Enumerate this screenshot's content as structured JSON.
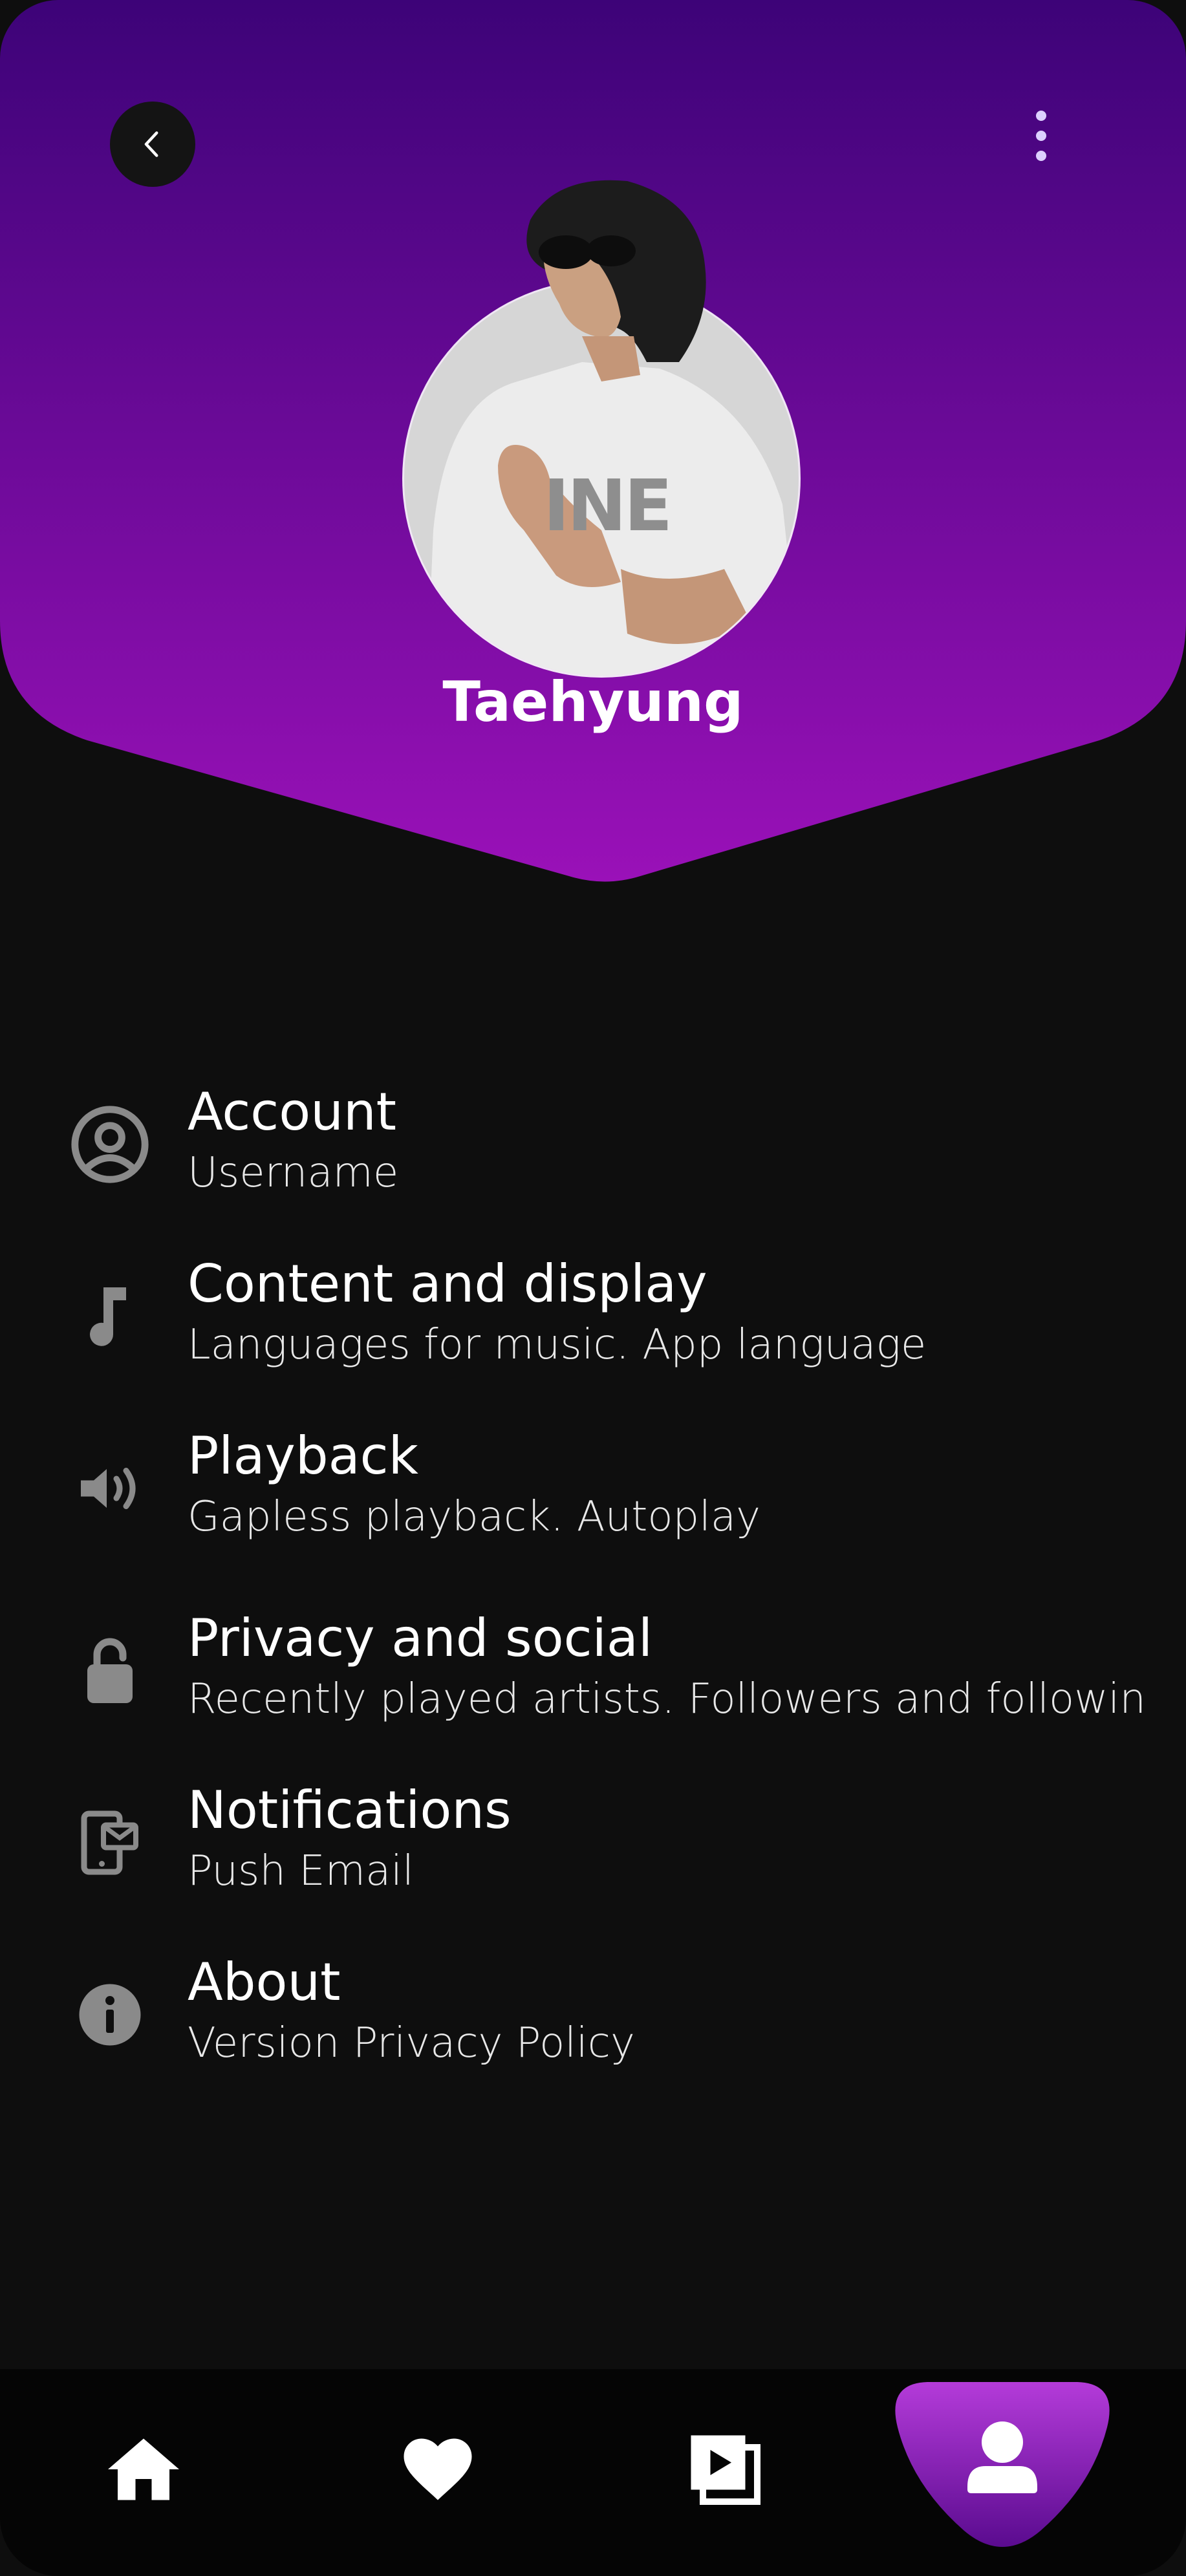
{
  "profile": {
    "name": "Taehyung"
  },
  "header": {
    "back_icon": "chevron-left-icon",
    "more_icon": "more-vertical-icon",
    "gradient_top": "#3d0378",
    "gradient_bottom": "#9a11b8"
  },
  "settings": {
    "items": [
      {
        "title": "Account",
        "subtitle": "Username",
        "icon": "account-circle-icon"
      },
      {
        "title": "Content and display",
        "subtitle": "Languages for music. App language",
        "icon": "music-note-icon"
      },
      {
        "title": "Playback",
        "subtitle": "Gapless playback. Autoplay",
        "icon": "volume-icon"
      },
      {
        "title": "Privacy and social",
        "subtitle": "Recently played artists. Followers and followin",
        "icon": "lock-icon"
      },
      {
        "title": "Notifications",
        "subtitle": "Push Email",
        "icon": "mail-phone-icon"
      },
      {
        "title": "About",
        "subtitle": "Version Privacy Policy",
        "icon": "info-icon"
      }
    ]
  },
  "bottom_nav": {
    "items": [
      {
        "icon": "home-icon",
        "active": false
      },
      {
        "icon": "heart-icon",
        "active": false
      },
      {
        "icon": "playlist-play-icon",
        "active": false
      },
      {
        "icon": "profile-icon",
        "active": true
      }
    ],
    "active_color": "#b43bd9"
  },
  "colors": {
    "background": "#0e0e0e",
    "icon_gray": "#8a8a8a",
    "accent": "#9a11b8"
  }
}
